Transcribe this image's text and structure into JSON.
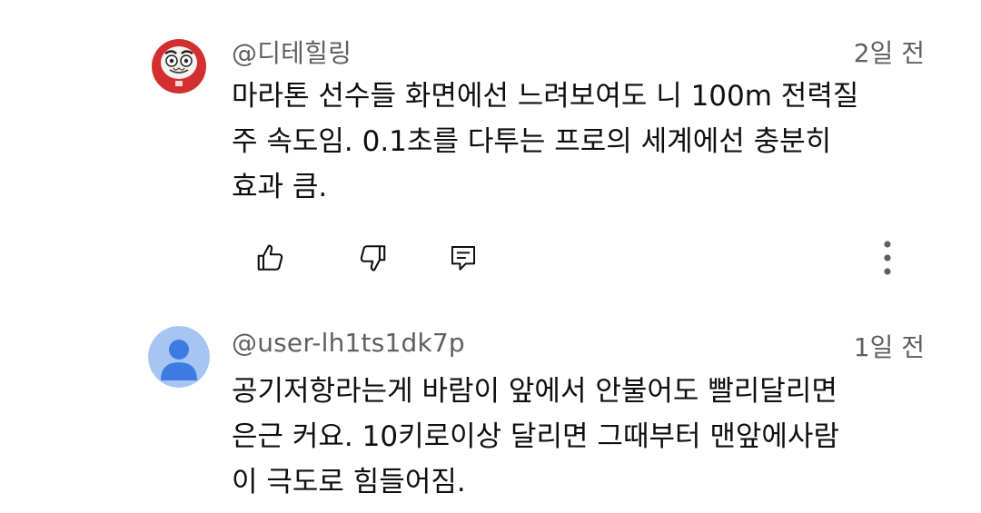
{
  "comments": [
    {
      "author": "@디테힐링",
      "time": "2일 전",
      "text": "마라톤 선수들 화면에선 느려보여도 니 100m 전력질\n주 속도임. 0.1초를 다투는 프로의 세계에선 충분히\n효과 큼.",
      "avatar": "daruma-doll-avatar",
      "actions": [
        "thumbs-up-icon",
        "thumbs-down-icon",
        "reply-icon",
        "more-options-icon"
      ]
    },
    {
      "author": "@user-lh1ts1dk7p",
      "time": "1일 전",
      "text": "공기저항라는게 바람이 앞에서 안불어도 빨리달리면\n은근 커요. 10키로이상 달리면 그때부터 맨앞에사람\n이 극도로 힘들어짐.",
      "avatar": "default-user-avatar"
    }
  ],
  "colors": {
    "meta_text": "#606060",
    "body_text": "#0f0f0f",
    "default_avatar_bg": "#a7c5f2",
    "default_avatar_fg": "#3e7be1",
    "daruma_red": "#d32f2f"
  }
}
